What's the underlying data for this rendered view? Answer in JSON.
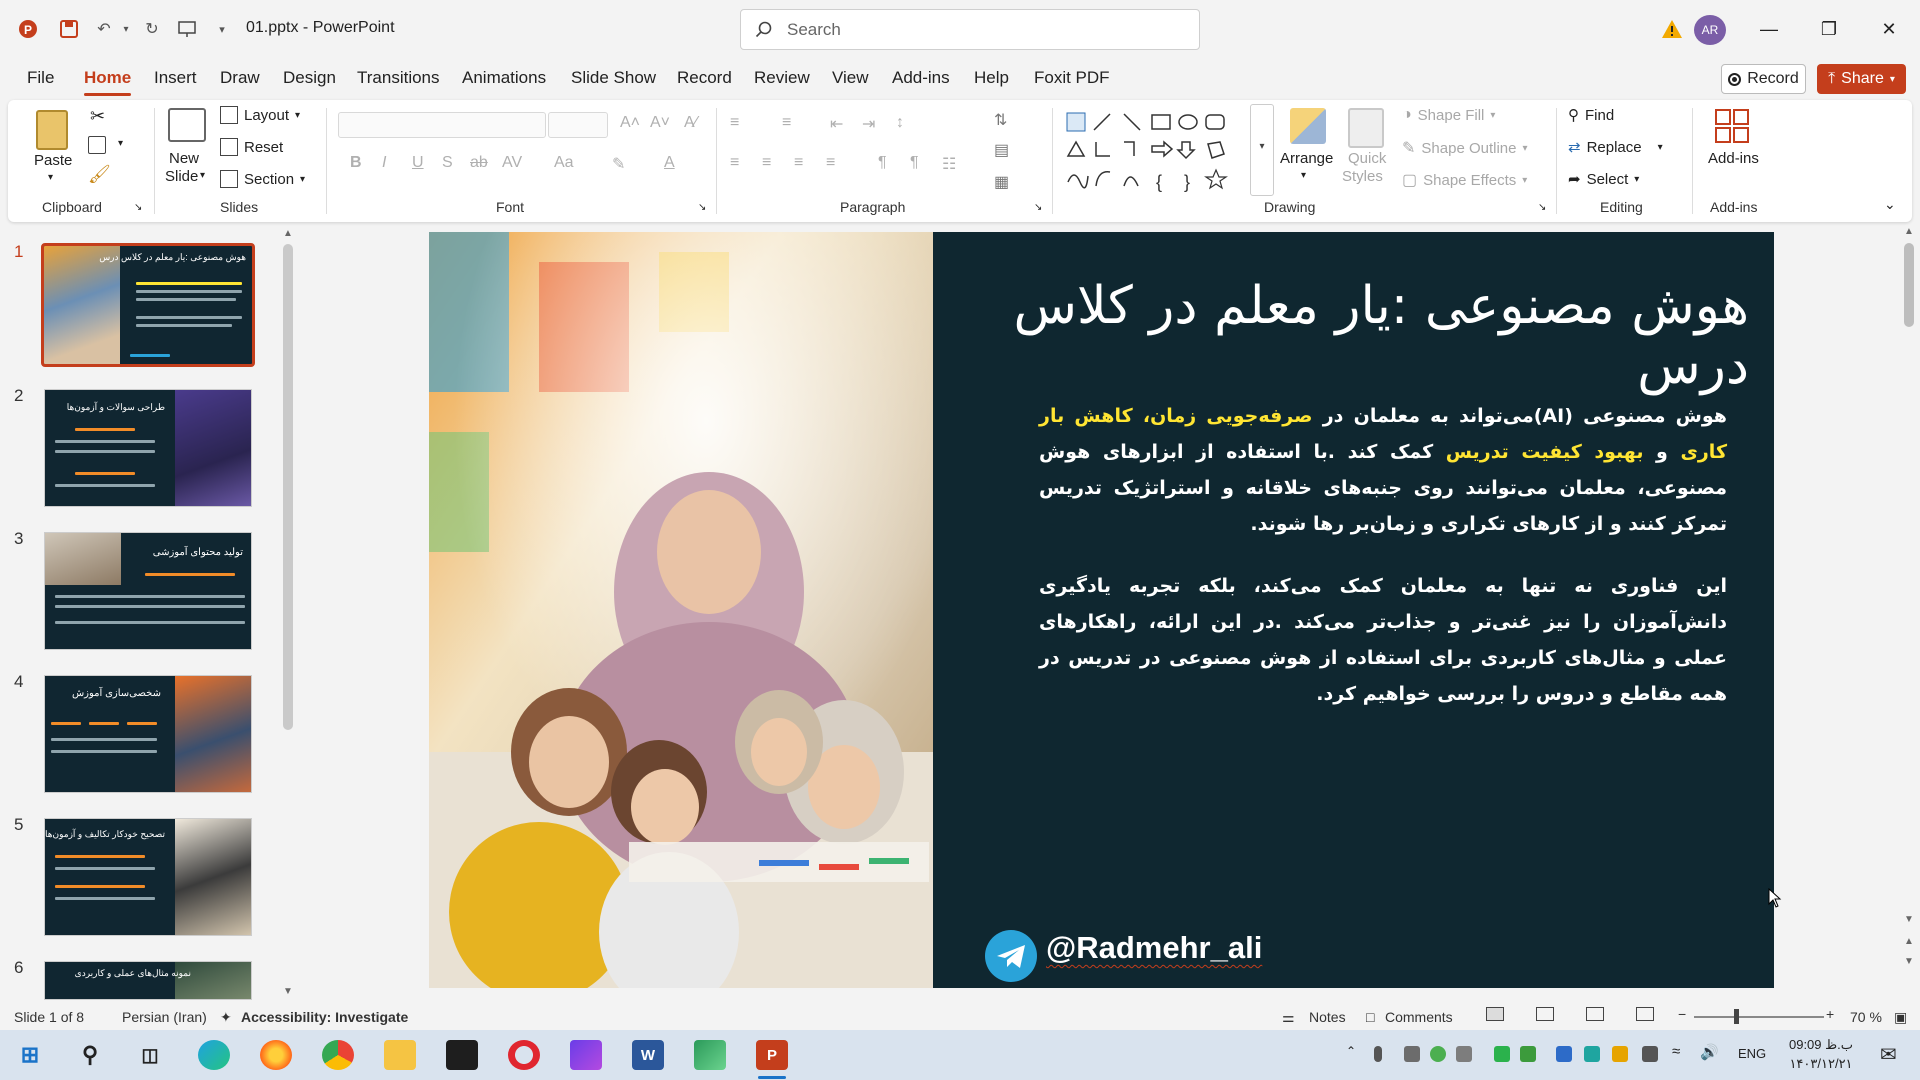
{
  "app": {
    "doc_title": "01.pptx  -  PowerPoint",
    "search_placeholder": "Search",
    "avatar_initials": "AR"
  },
  "menu": {
    "tabs": [
      "File",
      "Home",
      "Insert",
      "Draw",
      "Design",
      "Transitions",
      "Animations",
      "Slide Show",
      "Record",
      "Review",
      "View",
      "Add-ins",
      "Help",
      "Foxit PDF"
    ],
    "active_tab": "Home",
    "record_label": "Record",
    "share_label": "Share"
  },
  "ribbon": {
    "clipboard": {
      "paste": "Paste",
      "label": "Clipboard"
    },
    "slides": {
      "new_slide_1": "New",
      "new_slide_2": "Slide",
      "layout": "Layout",
      "reset": "Reset",
      "section": "Section",
      "label": "Slides"
    },
    "font": {
      "label": "Font"
    },
    "paragraph": {
      "label": "Paragraph"
    },
    "drawing": {
      "arrange": "Arrange",
      "quick_styles_1": "Quick",
      "quick_styles_2": "Styles",
      "shape_fill": "Shape Fill",
      "shape_outline": "Shape Outline",
      "shape_effects": "Shape Effects",
      "label": "Drawing"
    },
    "editing": {
      "find": "Find",
      "replace": "Replace",
      "select": "Select",
      "label": "Editing"
    },
    "addins": {
      "button": "Add-ins",
      "label": "Add-ins"
    }
  },
  "thumbnails": [
    {
      "num": "1",
      "title": "هوش مصنوعی :یار معلم در کلاس درس"
    },
    {
      "num": "2",
      "title": "طراحی سوالات و آزمون‌ها"
    },
    {
      "num": "3",
      "title": "تولید محتوای آموزشی"
    },
    {
      "num": "4",
      "title": "شخصی‌سازی آموزش"
    },
    {
      "num": "5",
      "title": "تصحیح خودکار تکالیف و آزمون‌ها"
    },
    {
      "num": "6",
      "title": "نمونه مثال‌های عملی و کاربردی"
    }
  ],
  "slide": {
    "title": "هوش مصنوعی :یار معلم در کلاس درس",
    "p1_a": "هوش مصنوعی  (AI)می‌تواند به معلمان در ",
    "p1_hl1": "صرفه‌جویی زمان، کاهش بار کاری",
    "p1_b": " و ",
    "p1_hl2": "بهبود کیفیت تدریس",
    "p1_c": " کمک کند .با استفاده از ابزارهای هوش مصنوعی، معلمان می‌توانند روی جنبه‌های خلاقانه و استراتژیک تدریس تمرکز کنند و از کارهای تکراری و زمان‌بر رها شوند.",
    "p2": "این فناوری نه تنها به معلمان کمک می‌کند، بلکه تجربه یادگیری دانش‌آموزان را نیز غنی‌تر و جذاب‌تر می‌کند .در این ارائه، راهکارهای عملی و مثال‌های کاربردی برای استفاده از هوش مصنوعی در تدریس در همه مقاطع و دروس را بررسی خواهیم کرد.",
    "handle": "@Radmehr_ali",
    "highlight_color": "#ffe533",
    "background_color": "#0f2730"
  },
  "status": {
    "slide_counter": "Slide 1 of 8",
    "language": "Persian (Iran)",
    "accessibility": "Accessibility: Investigate",
    "notes": "Notes",
    "comments": "Comments",
    "zoom": "70 %"
  },
  "taskbar": {
    "lang": "ENG",
    "time": "09:09 ب.ظ",
    "date": "۱۴۰۳/۱۲/۲۱"
  },
  "colors": {
    "accent": "#c43e1c"
  }
}
